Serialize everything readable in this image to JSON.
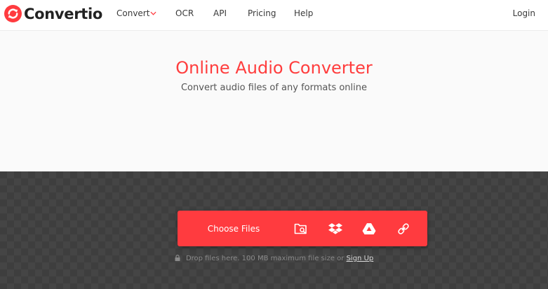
{
  "header": {
    "brand": "Convertio",
    "nav": [
      {
        "label": "Convert"
      },
      {
        "label": "OCR"
      },
      {
        "label": "API"
      },
      {
        "label": "Pricing"
      },
      {
        "label": "Help"
      }
    ],
    "login": "Login",
    "brand_color": "#ff3b3f"
  },
  "hero": {
    "title": "Online Audio Converter",
    "subtitle": "Convert audio files of any formats online"
  },
  "upload": {
    "choose_label": "Choose Files",
    "sources": [
      "folder-search-icon",
      "dropbox-icon",
      "google-drive-icon",
      "link-icon"
    ],
    "drop_note": "Drop files here. 100 MB maximum file size or",
    "signup": "Sign Up"
  }
}
